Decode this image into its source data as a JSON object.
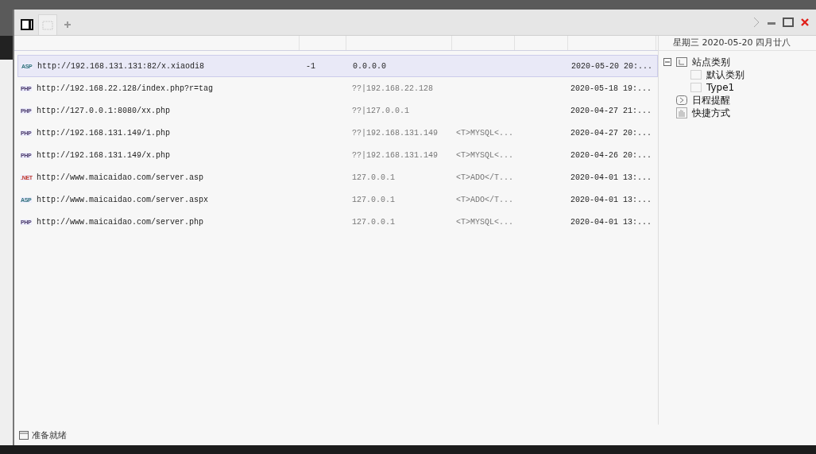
{
  "tabs": [
    {
      "kind": "panel",
      "selected": false
    },
    {
      "kind": "blank",
      "selected": true
    }
  ],
  "date_header": "星期三 2020-05-20 四月廿八",
  "rows": [
    {
      "type": "ASP",
      "url": "http://192.168.131.131:82/x.xiaodi8",
      "status": "-1",
      "ip": "0.0.0.0",
      "date": "2020-05-20 20:...",
      "selected": true
    },
    {
      "type": "PHP",
      "url": "http://192.168.22.128/index.php?r=tag",
      "ip": "??|192.168.22.128",
      "date": "2020-05-18 19:...",
      "selected": false
    },
    {
      "type": "PHP",
      "url": "http://127.0.0.1:8080/xx.php",
      "ip": "??|127.0.0.1",
      "date": "2020-04-27 21:...",
      "selected": false
    },
    {
      "type": "PHP",
      "url": "http://192.168.131.149/1.php",
      "ip": "??|192.168.131.149",
      "db": "<T>MYSQL<...",
      "date": "2020-04-27 20:...",
      "selected": false
    },
    {
      "type": "PHP",
      "url": "http://192.168.131.149/x.php",
      "ip": "??|192.168.131.149",
      "db": "<T>MYSQL<...",
      "date": "2020-04-26 20:...",
      "selected": false
    },
    {
      "type": ".NET",
      "url": "http://www.maicaidao.com/server.asp",
      "ip": "127.0.0.1",
      "db": "<T>ADO</T...",
      "date": "2020-04-01 13:...",
      "selected": false
    },
    {
      "type": "ASP",
      "url": "http://www.maicaidao.com/server.aspx",
      "ip": "127.0.0.1",
      "db": "<T>ADO</T...",
      "date": "2020-04-01 13:...",
      "selected": false
    },
    {
      "type": "PHP",
      "url": "http://www.maicaidao.com/server.php",
      "ip": "127.0.0.1",
      "db": "<T>MYSQL<...",
      "date": "2020-04-01 13:...",
      "selected": false
    }
  ],
  "tree": [
    {
      "kind": "category",
      "label": "站点类别",
      "expanded": true,
      "children": [
        {
          "label": "默认类别"
        },
        {
          "label": "Type1"
        }
      ]
    },
    {
      "kind": "schedule",
      "label": "日程提醒"
    },
    {
      "kind": "shortcut",
      "label": "快捷方式"
    }
  ],
  "status_bar": "准备就绪"
}
